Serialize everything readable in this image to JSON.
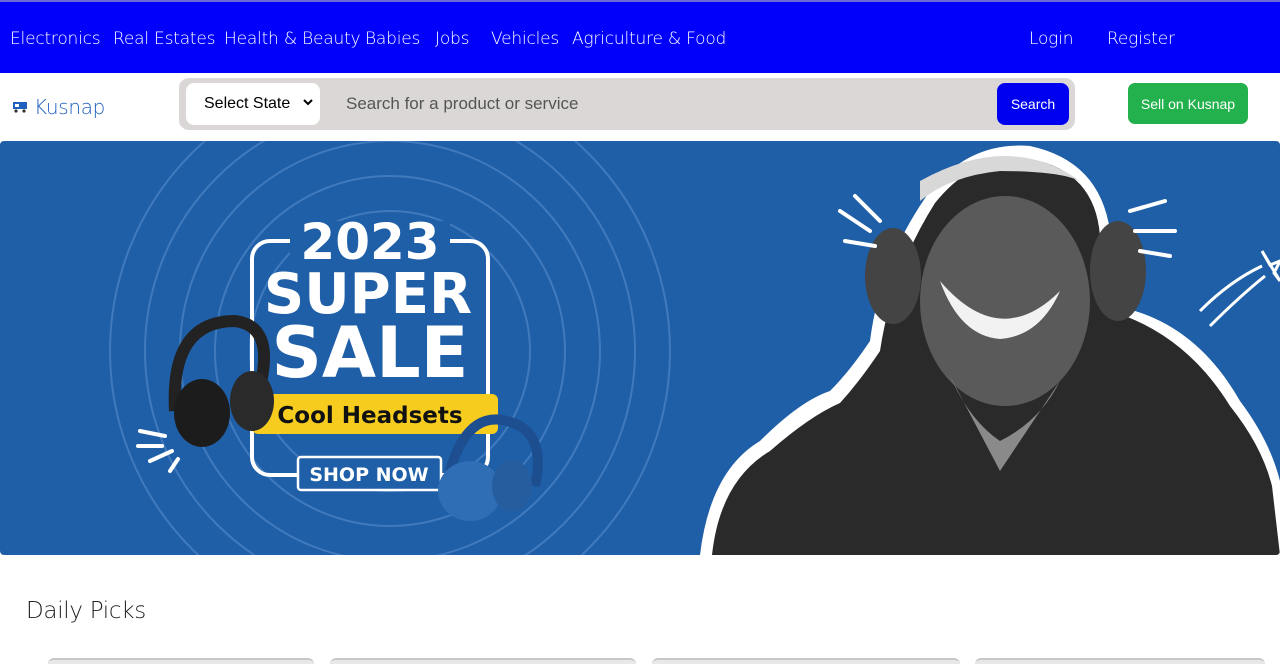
{
  "topnav": {
    "categories": [
      "Electronics",
      "Real Estates",
      "Health & Beauty",
      "Babies",
      "Jobs",
      "Vehicles",
      "Agriculture & Food"
    ],
    "login": "Login",
    "register": "Register"
  },
  "header": {
    "logo_text": "Kusnap",
    "state_select": "Select State",
    "search_placeholder": "Search for a product or service",
    "search_button": "Search",
    "sell_button": "Sell on Kusnap"
  },
  "banner": {
    "year": "2023",
    "line1": "SUPER",
    "line2": "SALE",
    "tag": "Cool Headsets",
    "cta": "SHOP NOW"
  },
  "sections": {
    "daily_picks": "Daily Picks"
  },
  "colors": {
    "nav_bg": "#0000fb",
    "search_btn": "#0000f0",
    "sell_btn": "#22b14c",
    "banner_bg": "#1f5fa8",
    "banner_tag": "#f6cd1f"
  }
}
